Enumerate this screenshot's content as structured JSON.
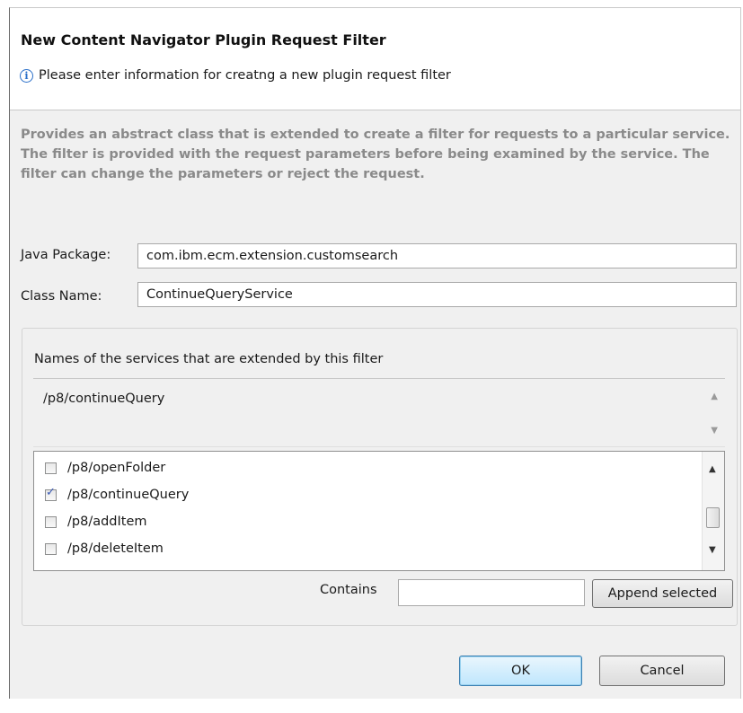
{
  "dialog": {
    "title": "New Content Navigator Plugin Request Filter",
    "info_message": "Please enter information for creatng a new plugin request filter",
    "info_icon_glyph": "i",
    "description": "Provides an abstract class that is extended to create a filter for requests to a particular service. The filter is provided with the request parameters before being examined by the service. The filter can change the parameters or reject the request."
  },
  "fields": {
    "java_package": {
      "label": "Java Package:",
      "value": "com.ibm.ecm.extension.customsearch"
    },
    "class_name": {
      "label": "Class Name:",
      "value": "ContinueQueryService"
    }
  },
  "services": {
    "group_label": "Names of the services that are extended by this filter",
    "selected_text": "/p8/continueQuery",
    "items": [
      {
        "label": "/p8/openFolder",
        "checked": false
      },
      {
        "label": "/p8/continueQuery",
        "checked": true
      },
      {
        "label": "/p8/addItem",
        "checked": false
      },
      {
        "label": "/p8/deleteItem",
        "checked": false
      }
    ],
    "contains_label": "Contains",
    "contains_value": "",
    "append_button": "Append selected"
  },
  "footer": {
    "ok_label": "OK",
    "cancel_label": "Cancel"
  },
  "colors": {
    "description_text": "#8a8a8a",
    "info_icon": "#2a6fc9",
    "default_button_border": "#3c7fb1"
  }
}
